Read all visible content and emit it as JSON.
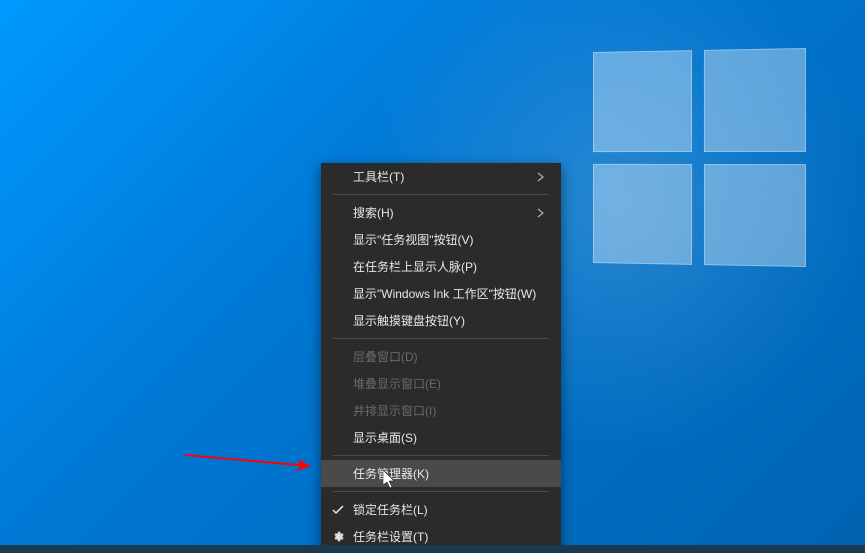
{
  "context_menu": {
    "items": [
      {
        "label": "工具栏(T)",
        "has_submenu": true
      },
      {
        "type": "separator"
      },
      {
        "label": "搜索(H)",
        "has_submenu": true
      },
      {
        "label": "显示\"任务视图\"按钮(V)"
      },
      {
        "label": "在任务栏上显示人脉(P)"
      },
      {
        "label": "显示\"Windows Ink 工作区\"按钮(W)"
      },
      {
        "label": "显示触摸键盘按钮(Y)"
      },
      {
        "type": "separator"
      },
      {
        "label": "层叠窗口(D)",
        "disabled": true
      },
      {
        "label": "堆叠显示窗口(E)",
        "disabled": true
      },
      {
        "label": "并排显示窗口(I)",
        "disabled": true
      },
      {
        "label": "显示桌面(S)"
      },
      {
        "type": "separator"
      },
      {
        "label": "任务管理器(K)",
        "highlighted": true
      },
      {
        "type": "separator"
      },
      {
        "label": "锁定任务栏(L)",
        "checked": true
      },
      {
        "label": "任务栏设置(T)",
        "icon": "gear"
      }
    ]
  }
}
